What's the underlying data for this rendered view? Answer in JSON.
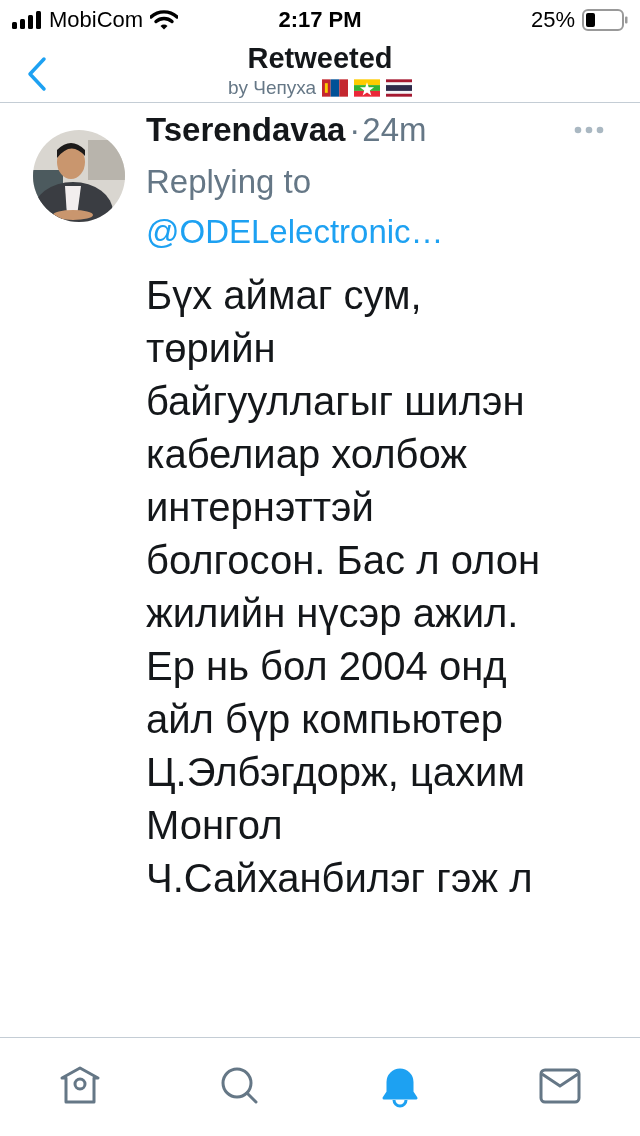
{
  "status_bar": {
    "carrier": "MobiCom",
    "time": "2:17 PM",
    "battery": "25%"
  },
  "header": {
    "title": "Retweeted",
    "subtitle": "by Чепуха",
    "flags": [
      {
        "kind": "mongolia"
      },
      {
        "kind": "myanmar"
      },
      {
        "kind": "thailand"
      }
    ]
  },
  "tweet": {
    "name": "Tserendavaa",
    "separator": "·",
    "time": "24m",
    "replying_label": "Replying to",
    "replying_handle": "@ODELelectronic…",
    "lines": [
      "Бүх аймаг сум,",
      "төрийн",
      "байгууллагыг шилэн",
      "кабелиар холбож",
      "интернэттэй",
      "болгосон. Бас л олон",
      "жилийн нүсэр ажил.",
      "Ер нь бол 2004 онд",
      "айл бүр компьютер",
      "Ц.Элбэгдорж, цахим",
      "Монгол",
      "Ч.Сайханбилэг гэж л"
    ]
  },
  "tab_bar": [
    {
      "kind": "home",
      "selected": false
    },
    {
      "kind": "search",
      "selected": false
    },
    {
      "kind": "notifications",
      "selected": true
    },
    {
      "kind": "messages",
      "selected": false
    }
  ]
}
